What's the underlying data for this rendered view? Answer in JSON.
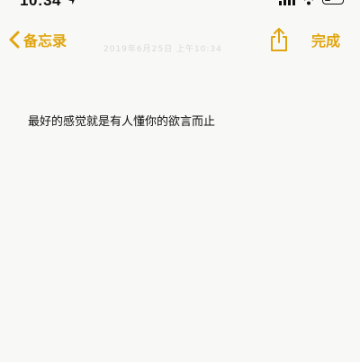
{
  "status_bar": {
    "time": "10:34",
    "location_icon": "location-arrow-icon",
    "signal_icon": "cellular-signal-icon",
    "wifi_icon": "wifi-icon",
    "battery_icon": "battery-icon"
  },
  "nav": {
    "back_label": "备忘录",
    "back_icon": "chevron-left-icon",
    "share_icon": "share-icon",
    "done_label": "完成",
    "date_text": "2019年6月25日 上午10:34"
  },
  "note": {
    "body": "最好的感觉就是有人懂你的欲言而止"
  },
  "colors": {
    "accent": "#e0a50f",
    "background": "#f8f8f6",
    "text": "#111111"
  }
}
